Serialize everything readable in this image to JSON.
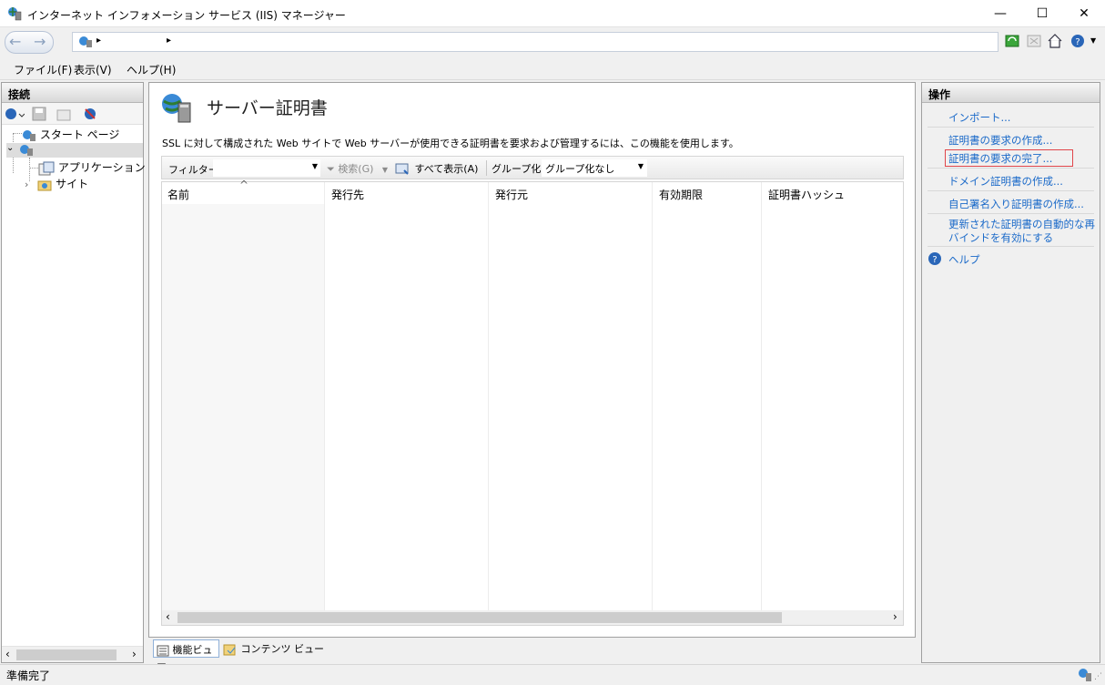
{
  "window": {
    "title": "インターネット インフォメーション サービス (IIS) マネージャー",
    "minimize_glyph": "—",
    "maximize_glyph": "☐",
    "close_glyph": "✕"
  },
  "addressbar": {
    "separator": "▸"
  },
  "menu": [
    "ファイル(F)",
    "表示(V)",
    "ヘルプ(H)"
  ],
  "connections": {
    "title": "接続",
    "tree": {
      "start_page": "スタート ページ",
      "server": "",
      "app_pools": "アプリケーション プール",
      "sites": "サイト"
    }
  },
  "feature": {
    "title": "サーバー証明書",
    "description": "SSL に対して構成された Web サイトで Web サーバーが使用できる証明書を要求および管理するには、この機能を使用します。",
    "filter_label": "フィルター:",
    "search_label": "検索(G)",
    "showall_label": "すべて表示(A)",
    "groupby_label": "グループ化:",
    "groupby_value": "グループ化なし",
    "columns": [
      "名前",
      "発行先",
      "発行元",
      "有効期限",
      "証明書ハッシュ"
    ],
    "sort_indicator": "^"
  },
  "view_tabs": {
    "feature_view": "機能ビュー",
    "content_view": "コンテンツ ビュー"
  },
  "actions": {
    "title": "操作",
    "items": [
      "インポート...",
      "証明書の要求の作成...",
      "証明書の要求の完了...",
      "ドメイン証明書の作成...",
      "自己署名入り証明書の作成...",
      "更新された証明書の自動的な再",
      "バインドを有効にする",
      "ヘルプ"
    ]
  },
  "status": {
    "text": "準備完了"
  },
  "colors": {
    "link": "#1b6ac9",
    "highlight_border": "#e0454a"
  }
}
